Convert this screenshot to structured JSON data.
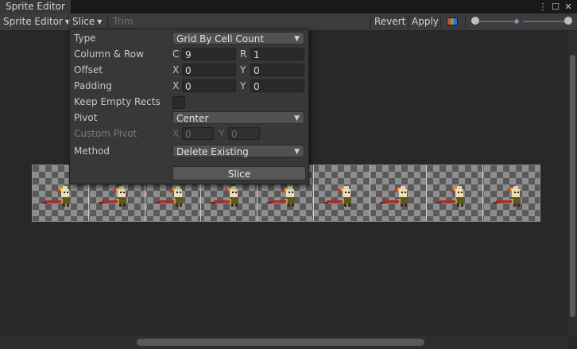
{
  "window": {
    "tab_title": "Sprite Editor",
    "more_icon": "⋮",
    "maximize_icon": "☐",
    "close_icon": "✕"
  },
  "toolbar": {
    "sprite_editor_label": "Sprite Editor",
    "slice_label": "Slice",
    "trim_label": "Trim",
    "revert_label": "Revert",
    "apply_label": "Apply",
    "zoom_level": 0.0
  },
  "slice_popup": {
    "type_label": "Type",
    "type_value": "Grid By Cell Count",
    "column_row_label": "Column & Row",
    "column_prefix": "C",
    "column_value": "9",
    "row_prefix": "R",
    "row_value": "1",
    "offset_label": "Offset",
    "offset_x_prefix": "X",
    "offset_x_value": "0",
    "offset_y_prefix": "Y",
    "offset_y_value": "0",
    "padding_label": "Padding",
    "padding_x_prefix": "X",
    "padding_x_value": "0",
    "padding_y_prefix": "Y",
    "padding_y_value": "0",
    "keep_empty_label": "Keep Empty Rects",
    "keep_empty_checked": false,
    "pivot_label": "Pivot",
    "pivot_value": "Center",
    "custom_pivot_label": "Custom Pivot",
    "custom_pivot_x_prefix": "X",
    "custom_pivot_x_value": "0",
    "custom_pivot_y_prefix": "Y",
    "custom_pivot_y_value": "0",
    "method_label": "Method",
    "method_value": "Delete Existing",
    "slice_button_label": "Slice"
  },
  "sprite_strip": {
    "frame_count": 9
  }
}
